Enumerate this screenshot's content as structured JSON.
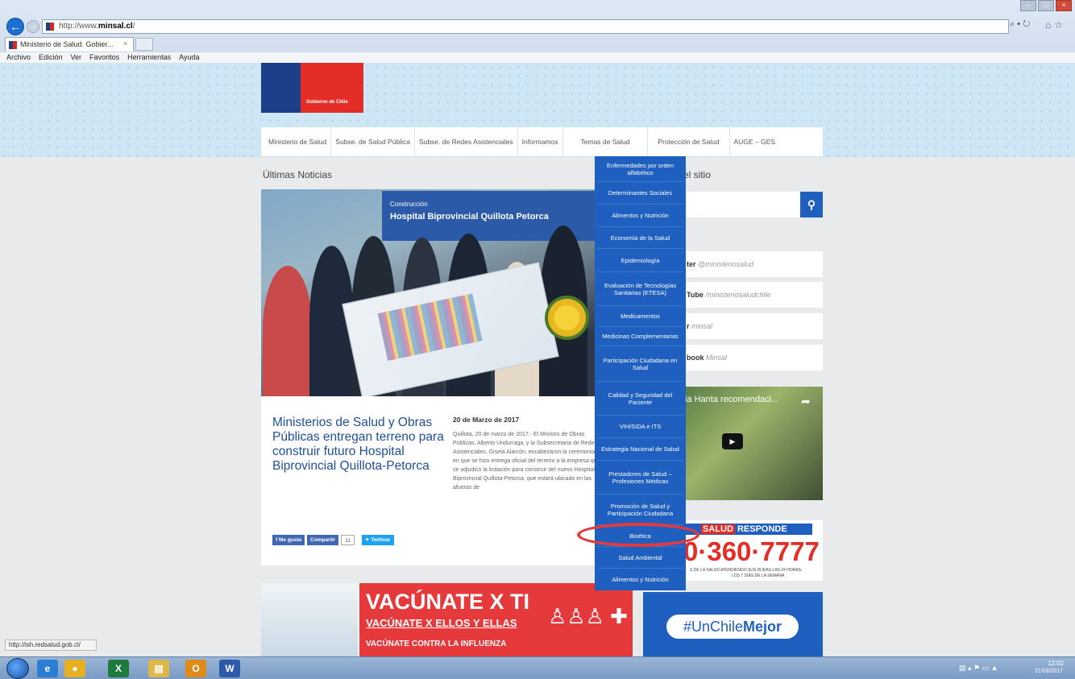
{
  "browser": {
    "address_prefix": "http://www.",
    "address_domain": "minsal.cl",
    "address_suffix": "/",
    "search_hint": "⌕ • ↻",
    "tab_title": "Ministerio de Salud. Gobier...",
    "tab_close": "×",
    "menu": [
      "Archivo",
      "Edición",
      "Ver",
      "Favoritos",
      "Herramientas",
      "Ayuda"
    ],
    "status_url": "http://ish.redsalud.gob.cl/"
  },
  "header": {
    "logo_text": "Gobierno de Chile"
  },
  "nav": {
    "items": [
      "Ministerio de Salud",
      "Subse. de Salud Pública",
      "Subse. de Redes Asistenciales",
      "Informamos",
      "Temas de Salud",
      "Protección de Salud",
      "AUGE – GES"
    ]
  },
  "news": {
    "section_title": "Últimas Noticias",
    "hero_banner_small": "Construcción",
    "hero_banner_big": "Hospital Biprovincial Quillota Petorca",
    "title": "Ministerios de Salud y Obras Públicas entregan terreno para construir futuro Hospital Biprovincial Quillota-Petorca",
    "date": "20 de Marzo de 2017",
    "body": "Quillota, 20 de marzo de 2017.- El Ministro de Obras Públicas, Alberto Undurraga, y la Subsecretaria de Redes Asistenciales, Gisela Alarcón, encabezaron la ceremonia en que se hizo entrega oficial del terreno a la empresa que se adjudicó la licitación para construir del nuevo Hospital Biprovincial Quillota-Petorca, que estará ubicado en las afueras de",
    "social": {
      "like": "Me gusta",
      "share": "Compartir",
      "count": "11",
      "tweet": "Twittear"
    }
  },
  "campaign": {
    "line1": "VACÚNATE X TI",
    "line2": "VACÚNATE X ELLOS Y ELLAS",
    "line3": "VACÚNATE CONTRA LA INFLUENZA"
  },
  "sidebar": {
    "search_label": "el sitio",
    "social": [
      {
        "name": "ter",
        "handle": "@ministeriosalud"
      },
      {
        "name": "Tube",
        "handle": "/ministeriosaludchile"
      },
      {
        "name": "r",
        "handle": "minsal"
      },
      {
        "name": "book",
        "handle": "Minsal"
      }
    ],
    "video_title": "ia Hanta recomendaci...",
    "responde_head_a": "SALUD",
    "responde_head_b": "RESPONDE",
    "responde_number": "0·360·7777",
    "responde_sub1": "S DE LA SALUD ATENDIENDO SUS DUDAS LAS 24 HORAS,",
    "responde_sub2": "LOS 7 DÍAS DE LA SEMANA",
    "unchile_a": "#UnChile",
    "unchile_b": "Mejor"
  },
  "dropdown": {
    "items": [
      "Enfermedades por orden alfabético",
      "Determinantes Sociales",
      "Alimentos y Nutrición",
      "Economía de la Salud",
      "Epidemiología",
      "Evaluación de Tecnologías Sanitarias (ETESA)",
      "Medicamentos",
      "Medicinas Complementarias",
      "Participación Ciudadana en Salud",
      "Calidad y Seguridad del Paciente",
      "VIH/SIDA e ITS",
      "Estrategia Nacional de Salud",
      "Prestadores de Salud – Profesiones Médicas",
      "Promoción de Salud y Participación Ciudadana",
      "Bioética",
      "Salud Ambiental",
      "Alimentos y Nutrición"
    ],
    "highlighted": "Bioética"
  },
  "taskbar": {
    "apps": [
      {
        "icon": "internet-explorer-icon",
        "glyph": "e",
        "color": "#2a7fd4"
      },
      {
        "icon": "chrome-icon",
        "glyph": "●",
        "color": "#e8b020"
      },
      {
        "icon": "excel-icon",
        "glyph": "X",
        "color": "#1e7a3c"
      },
      {
        "icon": "folder-icon",
        "glyph": "▤",
        "color": "#e0b84a"
      },
      {
        "icon": "outlook-icon",
        "glyph": "O",
        "color": "#e08a1a"
      },
      {
        "icon": "word-icon",
        "glyph": "W",
        "color": "#2b5aa8"
      }
    ],
    "time": "12:02",
    "date": "21/03/2017"
  },
  "colors": {
    "brand_blue": "#1f5fbf",
    "brand_red": "#e52d27",
    "highlight": "#e53a3c"
  }
}
